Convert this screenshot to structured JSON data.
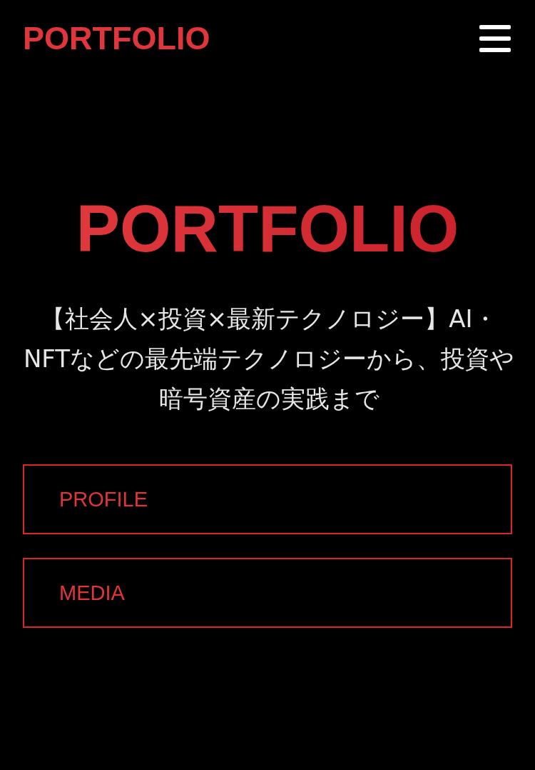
{
  "header": {
    "logo": "PORTFOLIO"
  },
  "hero": {
    "title": "PORTFOLIO",
    "subtitle": "【社会人×投資×最新テクノロジー】AI・NFTなどの最先端テクノロジーから、投資や暗号資産の実践まで"
  },
  "links": [
    {
      "label": "PROFILE"
    },
    {
      "label": "MEDIA"
    }
  ]
}
